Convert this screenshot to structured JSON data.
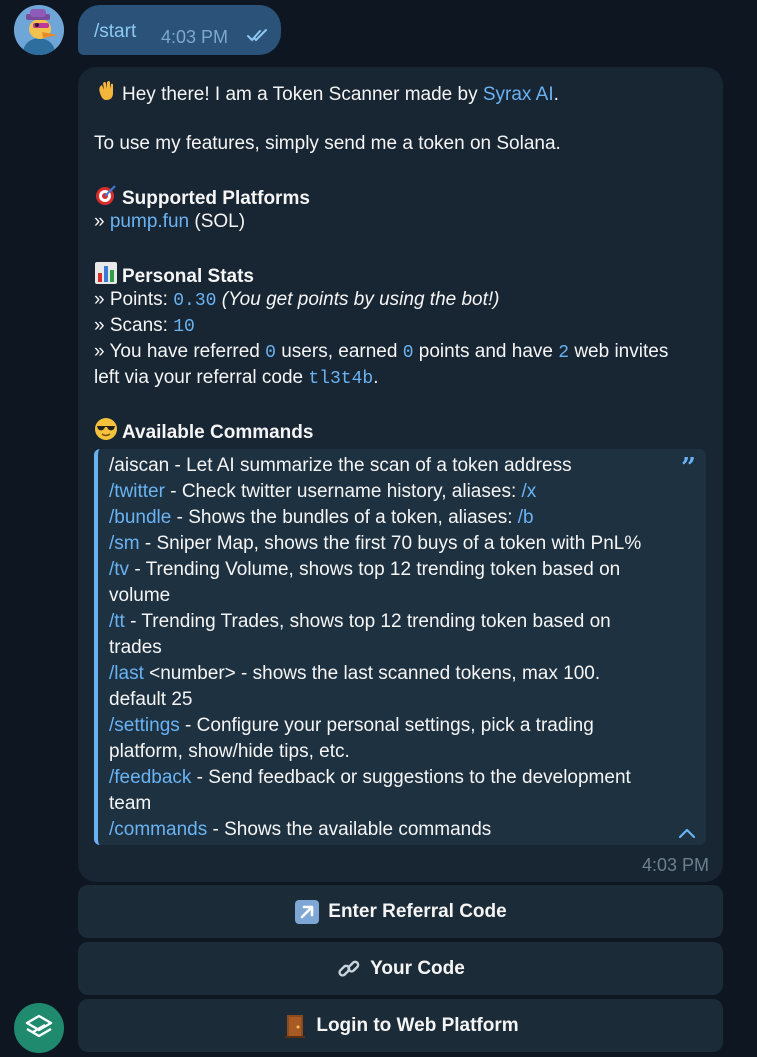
{
  "outgoing": {
    "text": "/start",
    "time": "4:03 PM"
  },
  "incoming": {
    "intro_prefix": "Hey there! I am a Token Scanner made by ",
    "intro_link": "Syrax AI",
    "intro_suffix": ".",
    "usage": "To use my features, simply send me a token on Solana.",
    "platforms": {
      "title": "Supported Platforms",
      "prefix": "» ",
      "link": "pump.fun",
      "suffix": " (SOL)"
    },
    "stats": {
      "title": "Personal Stats",
      "points_label": "» Points: ",
      "points_value": "0.30",
      "points_note": "(You get points by using the bot!)",
      "scans_label": "» Scans: ",
      "scans_value": "10",
      "ref_1": "» You have referred ",
      "ref_users": "0",
      "ref_2": " users, earned ",
      "ref_points": "0",
      "ref_3": " points and have ",
      "ref_invites": "2",
      "ref_4": " web invites",
      "ref_5": "left via your referral code ",
      "ref_code": "tl3t4b",
      "ref_6": "."
    },
    "commands": {
      "title": "Available Commands",
      "lines": [
        {
          "cmd": "",
          "text": "/aiscan - Let AI summarize the scan of a token address"
        },
        {
          "cmd": "/twitter",
          "text": " - Check twitter username history, aliases: ",
          "alias": "/x"
        },
        {
          "cmd": "/bundle",
          "text": " - Shows the bundles of a token, aliases: ",
          "alias": "/b"
        },
        {
          "cmd": "/sm",
          "text": " - Sniper Map, shows the first 70 buys of a token with PnL%"
        },
        {
          "cmd": "/tv",
          "text": " - Trending Volume, shows top 12 trending token based on"
        },
        {
          "cmd": "",
          "text": "volume"
        },
        {
          "cmd": "/tt",
          "text": " - Trending Trades, shows top 12 trending token based on"
        },
        {
          "cmd": "",
          "text": "trades"
        },
        {
          "cmd": "/last",
          "text": " <number> - shows the last scanned tokens, max 100."
        },
        {
          "cmd": "",
          "text": "default 25"
        },
        {
          "cmd": "/settings",
          "text": " - Configure your personal settings, pick a trading"
        },
        {
          "cmd": "",
          "text": "platform, show/hide tips, etc."
        },
        {
          "cmd": "/feedback",
          "text": " - Send feedback or suggestions to the development"
        },
        {
          "cmd": "",
          "text": "team"
        },
        {
          "cmd": "/commands",
          "text": " - Shows the available commands"
        }
      ]
    },
    "time": "4:03 PM"
  },
  "keyboard": [
    {
      "label": "Enter Referral Code",
      "icon": "arrow-up-right-icon"
    },
    {
      "label": "Your Code",
      "icon": "link-icon"
    },
    {
      "label": "Login to Web Platform",
      "icon": "door-icon"
    }
  ],
  "colors": {
    "background": "#0e1621",
    "outgoing_bubble": "#2b5278",
    "incoming_bubble": "#182533",
    "link": "#6ab3f3",
    "button": "#1c2b38"
  }
}
